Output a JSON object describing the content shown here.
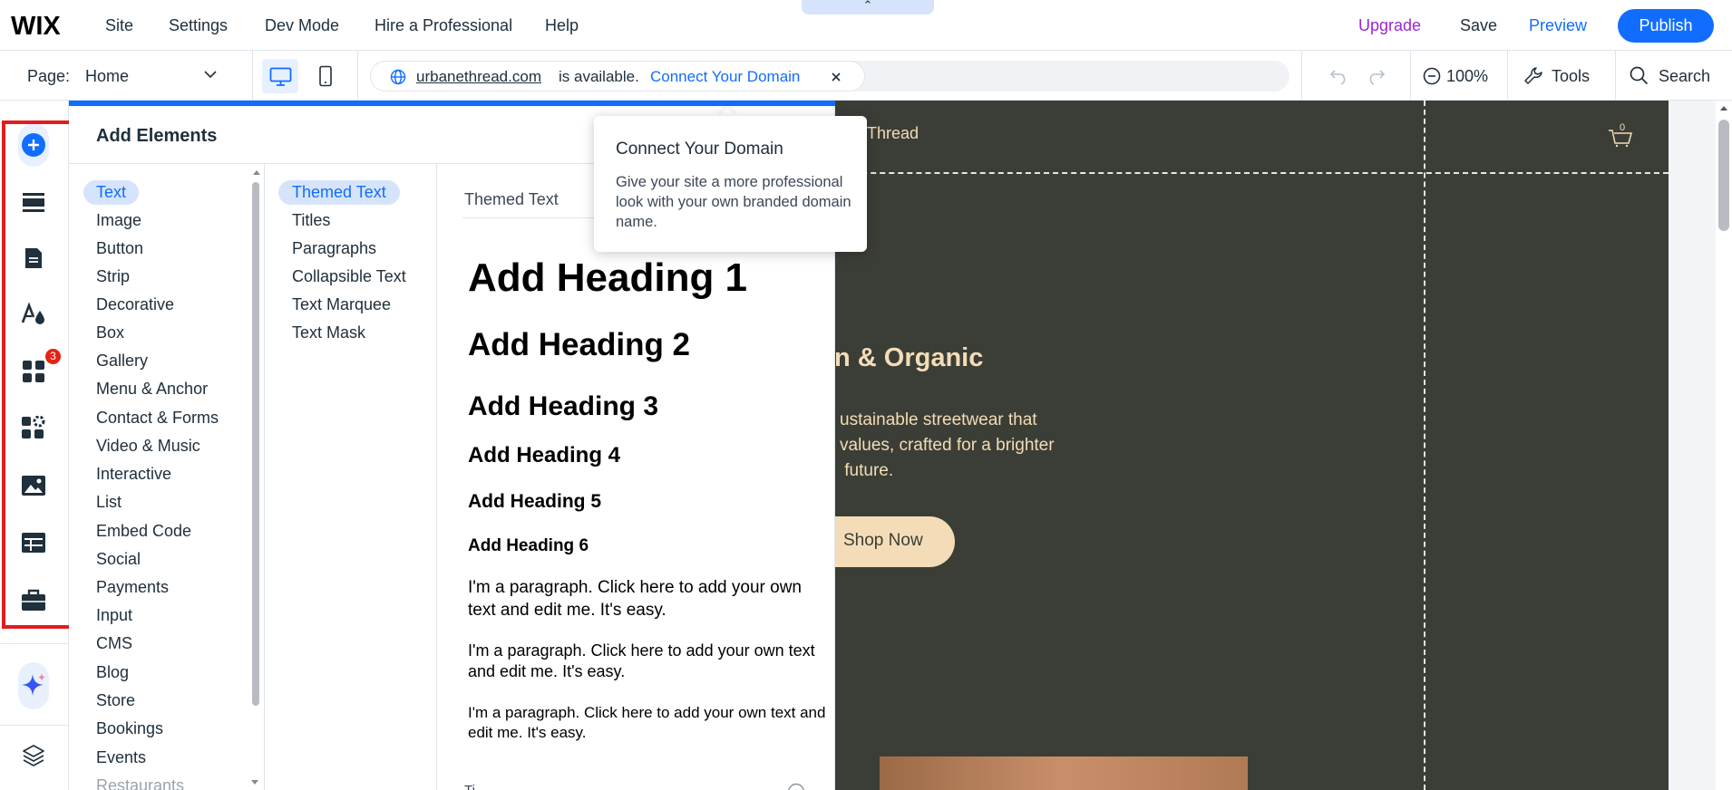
{
  "app": {
    "logo": "WIX",
    "menu": [
      "Site",
      "Settings",
      "Dev Mode",
      "Hire a Professional",
      "Help"
    ],
    "upgrade": "Upgrade",
    "save": "Save",
    "preview": "Preview",
    "publish": "Publish",
    "handle": "⌃"
  },
  "toolbar": {
    "page_label": "Page:",
    "page_value": "Home",
    "domain": "urbanethread.com",
    "available": "is available.",
    "connect": "Connect Your Domain",
    "zoom": "100%",
    "tools": "Tools",
    "search": "Search"
  },
  "rail": {
    "badge": "3",
    "icons": [
      "add-icon",
      "sections-icon",
      "pages-icon",
      "design-icon",
      "apps-icon",
      "business-apps-icon",
      "media-icon",
      "cms-icon",
      "portfolio-icon",
      "ai-assistant-icon",
      "layers-icon"
    ]
  },
  "panel": {
    "title": "Add Elements",
    "categories": [
      "Text",
      "Image",
      "Button",
      "Strip",
      "Decorative",
      "Box",
      "Gallery",
      "Menu & Anchor",
      "Contact & Forms",
      "Video & Music",
      "Interactive",
      "List",
      "Embed Code",
      "Social",
      "Payments",
      "Input",
      "CMS",
      "Blog",
      "Store",
      "Bookings",
      "Events",
      "Restaurants"
    ],
    "subcategories": [
      "Themed Text",
      "Titles",
      "Paragraphs",
      "Collapsible Text",
      "Text Marquee",
      "Text Mask"
    ],
    "section_label": "Themed Text",
    "headings": [
      "Add Heading 1",
      "Add Heading 2",
      "Add Heading 3",
      "Add Heading 4",
      "Add Heading 5",
      "Add Heading 6"
    ],
    "paragraphs": [
      "I'm a paragraph. Click here to add your own text and edit me. It's easy.",
      "I'm a paragraph. Click here to add your own text and edit me. It's easy.",
      "I'm a paragraph. Click here to add your own text and edit me. It's easy."
    ],
    "bottom_label": "Ti"
  },
  "tooltip": {
    "title": "Connect Your Domain",
    "body": "Give your site a more professional look with your own branded domain name."
  },
  "site": {
    "brand_fragment": "Thread",
    "cart_count": "0",
    "headline_fragment": "n & Organic",
    "body_fragment": "ustainable streetwear that\nvalues, crafted for a brighter\n future.",
    "button_fragment": "Shop Now"
  },
  "colors": {
    "accent": "#116dff",
    "upgrade": "#9a27d5",
    "canvas_bg": "#3b3e36",
    "site_text": "#f3dcb7",
    "shop_btn": "#f3dcb7",
    "highlight_box": "#e11d1d"
  }
}
